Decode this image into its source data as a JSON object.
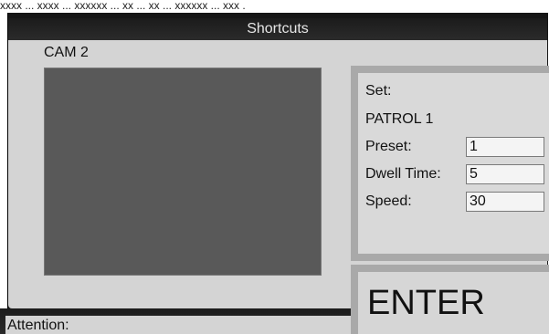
{
  "top_caption": "xxxx ... xxxx ... xxxxxx ... xx ... xx ... xxxxxx ... xxx .",
  "window": {
    "title": "Shortcuts"
  },
  "camera": {
    "label": "CAM 2"
  },
  "patrol_panel": {
    "set_label": "Set:",
    "patrol_name": "PATROL 1",
    "preset_label": "Preset:",
    "preset_value": "1",
    "dwell_label": "Dwell Time:",
    "dwell_value": "5",
    "speed_label": "Speed:",
    "speed_value": "30"
  },
  "enter_button": {
    "label": "ENTER"
  },
  "status": {
    "attention_label": "Attention:"
  },
  "colors": {
    "title_bar": "#1f1f1f",
    "content_bg": "#d4d4d4",
    "video_bg": "#595959",
    "panel_border": "#a9a9a9"
  }
}
